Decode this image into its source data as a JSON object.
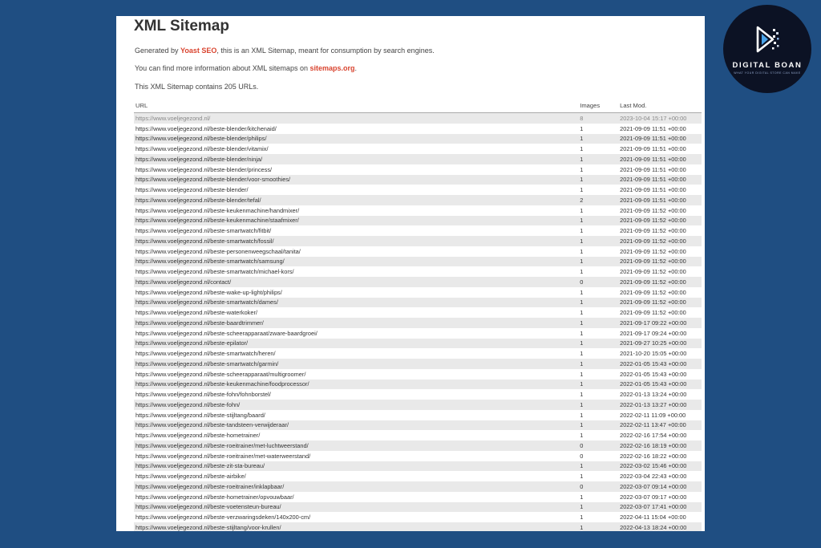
{
  "page": {
    "title": "XML Sitemap",
    "intro_prefix": "Generated by ",
    "intro_link": "Yoast SEO",
    "intro_suffix": ", this is an XML Sitemap, meant for consumption by search engines.",
    "info_prefix": "You can find more information about XML sitemaps on ",
    "info_link": "sitemaps.org",
    "info_suffix": ".",
    "count_text": "This XML Sitemap contains 205 URLs."
  },
  "colors": {
    "link": "#d9442f",
    "background": "#1f4e82"
  },
  "table": {
    "headers": {
      "url": "URL",
      "images": "Images",
      "last_mod": "Last Mod."
    },
    "rows": [
      {
        "url": "https://www.voeljegezond.nl/",
        "images": "8",
        "last_mod": "2023-10-04 15:17 +00:00"
      },
      {
        "url": "https://www.voeljegezond.nl/beste-blender/kitchenaid/",
        "images": "1",
        "last_mod": "2021-09-09 11:51 +00:00"
      },
      {
        "url": "https://www.voeljegezond.nl/beste-blender/philips/",
        "images": "1",
        "last_mod": "2021-09-09 11:51 +00:00"
      },
      {
        "url": "https://www.voeljegezond.nl/beste-blender/vitamix/",
        "images": "1",
        "last_mod": "2021-09-09 11:51 +00:00"
      },
      {
        "url": "https://www.voeljegezond.nl/beste-blender/ninja/",
        "images": "1",
        "last_mod": "2021-09-09 11:51 +00:00"
      },
      {
        "url": "https://www.voeljegezond.nl/beste-blender/princess/",
        "images": "1",
        "last_mod": "2021-09-09 11:51 +00:00"
      },
      {
        "url": "https://www.voeljegezond.nl/beste-blender/voor-smoothies/",
        "images": "1",
        "last_mod": "2021-09-09 11:51 +00:00"
      },
      {
        "url": "https://www.voeljegezond.nl/beste-blender/",
        "images": "1",
        "last_mod": "2021-09-09 11:51 +00:00"
      },
      {
        "url": "https://www.voeljegezond.nl/beste-blender/tefal/",
        "images": "2",
        "last_mod": "2021-09-09 11:51 +00:00"
      },
      {
        "url": "https://www.voeljegezond.nl/beste-keukenmachine/handmixer/",
        "images": "1",
        "last_mod": "2021-09-09 11:52 +00:00"
      },
      {
        "url": "https://www.voeljegezond.nl/beste-keukenmachine/staafmixer/",
        "images": "1",
        "last_mod": "2021-09-09 11:52 +00:00"
      },
      {
        "url": "https://www.voeljegezond.nl/beste-smartwatch/fitbit/",
        "images": "1",
        "last_mod": "2021-09-09 11:52 +00:00"
      },
      {
        "url": "https://www.voeljegezond.nl/beste-smartwatch/fossil/",
        "images": "1",
        "last_mod": "2021-09-09 11:52 +00:00"
      },
      {
        "url": "https://www.voeljegezond.nl/beste-personenweegschaal/tanita/",
        "images": "1",
        "last_mod": "2021-09-09 11:52 +00:00"
      },
      {
        "url": "https://www.voeljegezond.nl/beste-smartwatch/samsung/",
        "images": "1",
        "last_mod": "2021-09-09 11:52 +00:00"
      },
      {
        "url": "https://www.voeljegezond.nl/beste-smartwatch/michael-kors/",
        "images": "1",
        "last_mod": "2021-09-09 11:52 +00:00"
      },
      {
        "url": "https://www.voeljegezond.nl/contact/",
        "images": "0",
        "last_mod": "2021-09-09 11:52 +00:00"
      },
      {
        "url": "https://www.voeljegezond.nl/beste-wake-up-light/philips/",
        "images": "1",
        "last_mod": "2021-09-09 11:52 +00:00"
      },
      {
        "url": "https://www.voeljegezond.nl/beste-smartwatch/dames/",
        "images": "1",
        "last_mod": "2021-09-09 11:52 +00:00"
      },
      {
        "url": "https://www.voeljegezond.nl/beste-waterkoker/",
        "images": "1",
        "last_mod": "2021-09-09 11:52 +00:00"
      },
      {
        "url": "https://www.voeljegezond.nl/beste-baardtrimmer/",
        "images": "1",
        "last_mod": "2021-09-17 09:22 +00:00"
      },
      {
        "url": "https://www.voeljegezond.nl/beste-scheerapparaat/zware-baardgroei/",
        "images": "1",
        "last_mod": "2021-09-17 09:24 +00:00"
      },
      {
        "url": "https://www.voeljegezond.nl/beste-epilator/",
        "images": "1",
        "last_mod": "2021-09-27 10:25 +00:00"
      },
      {
        "url": "https://www.voeljegezond.nl/beste-smartwatch/heren/",
        "images": "1",
        "last_mod": "2021-10-20 15:05 +00:00"
      },
      {
        "url": "https://www.voeljegezond.nl/beste-smartwatch/garmin/",
        "images": "1",
        "last_mod": "2022-01-05 15:43 +00:00"
      },
      {
        "url": "https://www.voeljegezond.nl/beste-scheerapparaat/multigroomer/",
        "images": "1",
        "last_mod": "2022-01-05 15:43 +00:00"
      },
      {
        "url": "https://www.voeljegezond.nl/beste-keukenmachine/foodprocessor/",
        "images": "1",
        "last_mod": "2022-01-05 15:43 +00:00"
      },
      {
        "url": "https://www.voeljegezond.nl/beste-fohn/fohnborstel/",
        "images": "1",
        "last_mod": "2022-01-13 13:24 +00:00"
      },
      {
        "url": "https://www.voeljegezond.nl/beste-fohn/",
        "images": "1",
        "last_mod": "2022-01-13 13:27 +00:00"
      },
      {
        "url": "https://www.voeljegezond.nl/beste-stijltang/baard/",
        "images": "1",
        "last_mod": "2022-02-11 11:09 +00:00"
      },
      {
        "url": "https://www.voeljegezond.nl/beste-tandsteen-verwijderaar/",
        "images": "1",
        "last_mod": "2022-02-11 13:47 +00:00"
      },
      {
        "url": "https://www.voeljegezond.nl/beste-hometrainer/",
        "images": "1",
        "last_mod": "2022-02-16 17:54 +00:00"
      },
      {
        "url": "https://www.voeljegezond.nl/beste-roeitrainer/met-luchtweerstand/",
        "images": "0",
        "last_mod": "2022-02-16 18:19 +00:00"
      },
      {
        "url": "https://www.voeljegezond.nl/beste-roeitrainer/met-waterweerstand/",
        "images": "0",
        "last_mod": "2022-02-16 18:22 +00:00"
      },
      {
        "url": "https://www.voeljegezond.nl/beste-zit-sta-bureau/",
        "images": "1",
        "last_mod": "2022-03-02 15:46 +00:00"
      },
      {
        "url": "https://www.voeljegezond.nl/beste-airbike/",
        "images": "1",
        "last_mod": "2022-03-04 22:43 +00:00"
      },
      {
        "url": "https://www.voeljegezond.nl/beste-roeitrainer/inklapbaar/",
        "images": "0",
        "last_mod": "2022-03-07 09:14 +00:00"
      },
      {
        "url": "https://www.voeljegezond.nl/beste-hometrainer/opvouwbaar/",
        "images": "1",
        "last_mod": "2022-03-07 09:17 +00:00"
      },
      {
        "url": "https://www.voeljegezond.nl/beste-voetensteun-bureau/",
        "images": "1",
        "last_mod": "2022-03-07 17:41 +00:00"
      },
      {
        "url": "https://www.voeljegezond.nl/beste-verzwaringsdeken/140x200-cm/",
        "images": "1",
        "last_mod": "2022-04-11 15:04 +00:00"
      },
      {
        "url": "https://www.voeljegezond.nl/beste-stijltang/voor-krullen/",
        "images": "1",
        "last_mod": "2022-04-13 18:24 +00:00"
      }
    ]
  },
  "logo": {
    "name": "DIGITAL BOAN",
    "tagline": "WHAT YOUR DIGITAL STORE CAN MAKE",
    "icon": "play-arrow-pixel-icon"
  }
}
